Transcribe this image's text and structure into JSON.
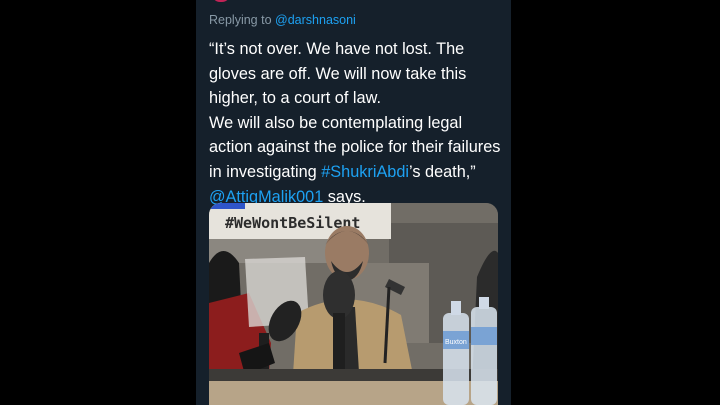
{
  "tweet": {
    "replying_prefix": "Replying to",
    "replying_handle": "@darshnasoni",
    "paragraph1": "“It’s not over. We have not lost. The gloves are off. We will now take this higher, to a court of law.",
    "paragraph2_before": "We will also be contemplating legal action against the police for their failures in investigating ",
    "hashtag": "#ShukriAbdi",
    "paragraph2_middle": "’s death,” ",
    "mention": "@AttiqMalik001",
    "paragraph2_after": " says."
  },
  "media": {
    "banner_text": "#WeWontBeSilent",
    "bottle_label": "Buxton"
  },
  "colors": {
    "background": "#000000",
    "panel": "#15202b",
    "text": "#ffffff",
    "muted": "#8899a6",
    "link": "#1da1f2"
  }
}
